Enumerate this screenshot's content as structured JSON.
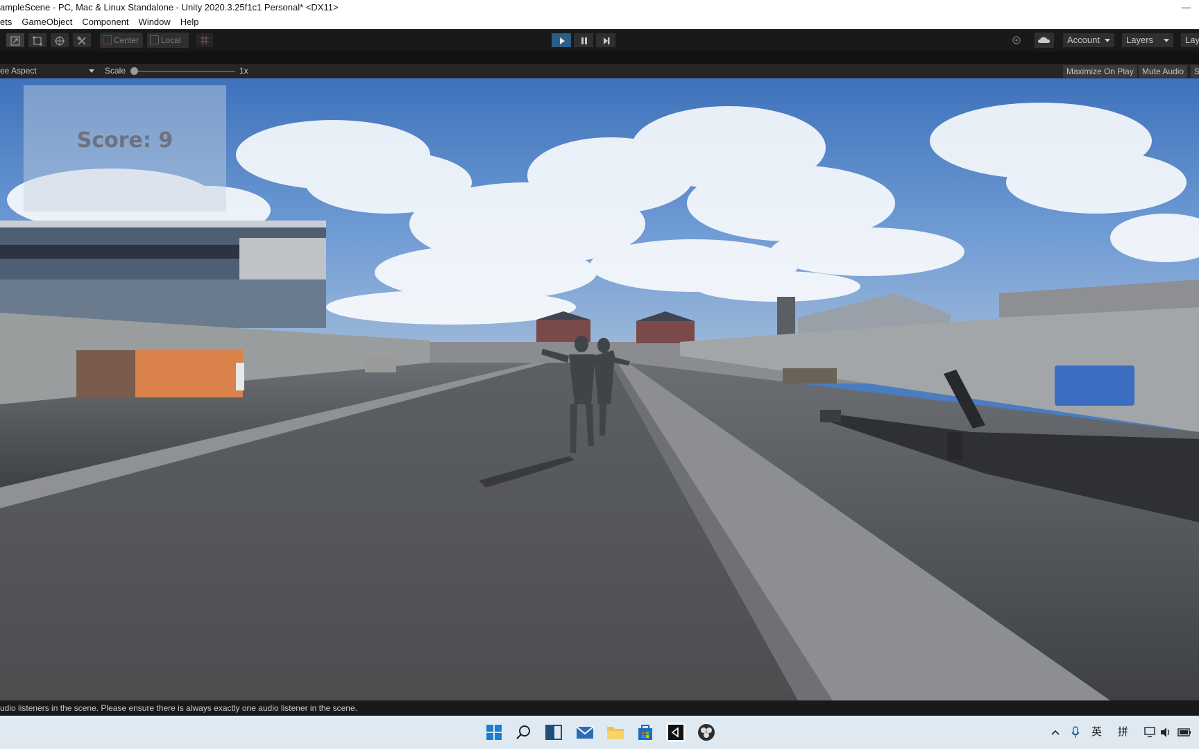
{
  "window": {
    "title": "ampleScene - PC, Mac & Linux Standalone - Unity 2020.3.25f1c1 Personal* <DX11>",
    "minimize_glyph": "—"
  },
  "menu": {
    "items": [
      "ets",
      "GameObject",
      "Component",
      "Window",
      "Help"
    ]
  },
  "toolbar": {
    "tools": [
      "rect-transform-tool-icon",
      "rect-tool-icon",
      "transform-tool-icon",
      "custom-tool-icon"
    ],
    "pivot_label": "Center",
    "space_label": "Local",
    "grid_icon": "grid-snap-icon",
    "play_state": "playing",
    "account_label": "Account",
    "layers_label": "Layers",
    "layout_label": "Lay"
  },
  "game_view": {
    "aspect_label": "ee Aspect",
    "scale_label": "Scale",
    "scale_value": "1x",
    "maximize_label": "Maximize On Play",
    "mute_label": "Mute Audio",
    "stats_label": "S"
  },
  "hud": {
    "score_text": "Score: 9"
  },
  "console": {
    "message": "udio listeners in the scene. Please ensure there is always exactly one audio listener in the scene."
  },
  "taskbar": {
    "apps": [
      "windows-start-icon",
      "search-icon",
      "task-view-icon",
      "mail-icon",
      "file-explorer-icon",
      "store-icon",
      "unity-icon",
      "obs-icon"
    ],
    "tray": {
      "ime_lang": "英",
      "ime_mode": "拼"
    }
  },
  "colors": {
    "editor_dark": "#191919",
    "play_active": "#2c5d87",
    "sky": "#4a7cbf",
    "taskbar": "#dfe9f2"
  }
}
